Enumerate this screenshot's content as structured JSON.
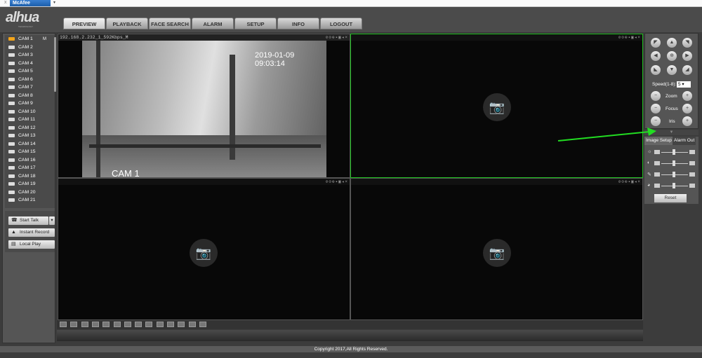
{
  "browser": {
    "close": "x",
    "addon": "McAfee",
    "dropdown": "▾"
  },
  "brand": {
    "logo": "alhua",
    "sub": "TECHNOLOGY"
  },
  "nav": [
    {
      "label": "PREVIEW",
      "active": true
    },
    {
      "label": "PLAYBACK"
    },
    {
      "label": "FACE SEARCH"
    },
    {
      "label": "ALARM"
    },
    {
      "label": "SETUP"
    },
    {
      "label": "INFO"
    },
    {
      "label": "LOGOUT"
    }
  ],
  "cameras": [
    "CAM 1",
    "CAM 2",
    "CAM 3",
    "CAM 4",
    "CAM 5",
    "CAM 6",
    "CAM 7",
    "CAM 8",
    "CAM 9",
    "CAM 10",
    "CAM 11",
    "CAM 12",
    "CAM 13",
    "CAM 14",
    "CAM 15",
    "CAM 16",
    "CAM 17",
    "CAM 18",
    "CAM 19",
    "CAM 20",
    "CAM 21"
  ],
  "cam1_badge": "M",
  "actions": {
    "talk": "Start Talk",
    "record": "Instant Record",
    "local": "Local Play"
  },
  "stream": {
    "info": "192.168.2.232_1_592Kbps_M",
    "timestamp": "2019-01-09 09:03:14",
    "osd_name": "CAM 1",
    "icons": "⊘⊙⊕▪▣◂×"
  },
  "ptz": {
    "speed_label": "Speed(1-8):",
    "speed": "5",
    "zoom": "Zoom",
    "focus": "Focus",
    "iris": "Iris"
  },
  "image_setup": {
    "tab1": "Image Setup",
    "tab2": "Alarm Out",
    "reset": "Reset"
  },
  "footer": "Copyright 2017,All Rights Reserved.",
  "colors": {
    "accent": "#f2a41a",
    "selected_border": "#1fbf1f",
    "arrow": "#22dd22"
  }
}
